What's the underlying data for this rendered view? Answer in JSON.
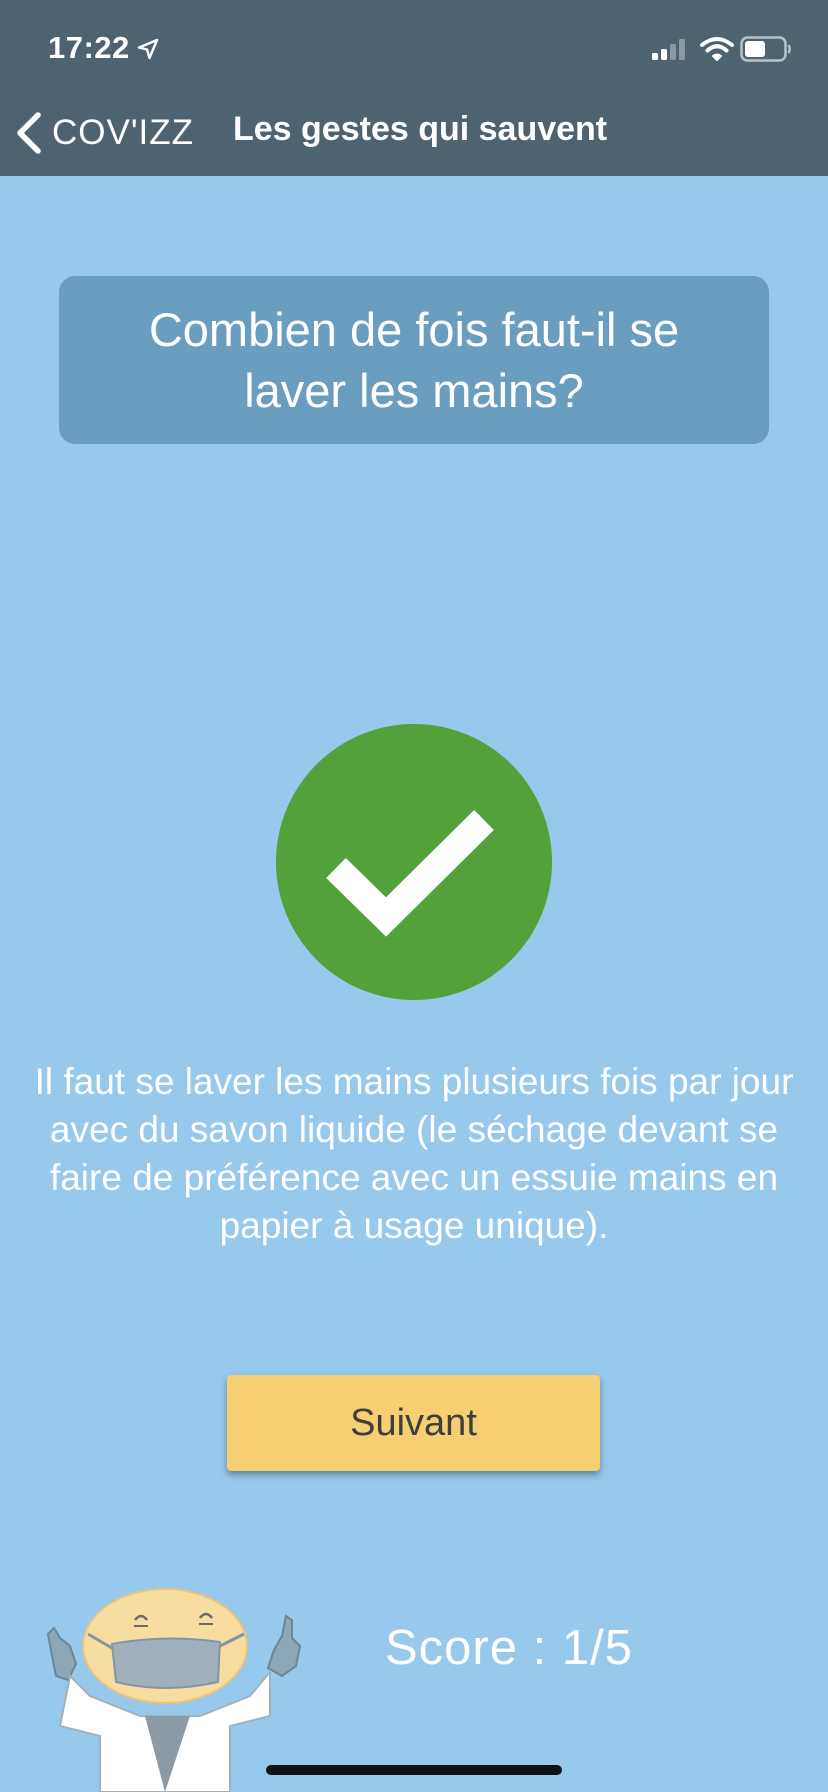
{
  "status_bar": {
    "time": "17:22"
  },
  "nav": {
    "back_label": "COV'IZZ",
    "title": "Les gestes qui sauvent"
  },
  "quiz": {
    "question": "Combien de fois faut-il se laver les mains?",
    "result": "correct",
    "explanation": "Il faut se laver les mains plusieurs fois par jour avec du savon liquide (le séchage devant se faire de préférence avec un essuie mains en papier à usage unique).",
    "next_label": "Suivant",
    "score": "Score : 1/5"
  },
  "colors": {
    "background": "#97C9EC",
    "nav_bar": "#4F6270",
    "question_card": "#6A9EC1",
    "correct": "#52A13B",
    "next_button": "#F5CF71"
  },
  "icons": [
    "location-arrow-icon",
    "signal-icon",
    "wifi-icon",
    "battery-icon",
    "chevron-left-icon",
    "checkmark-icon"
  ]
}
